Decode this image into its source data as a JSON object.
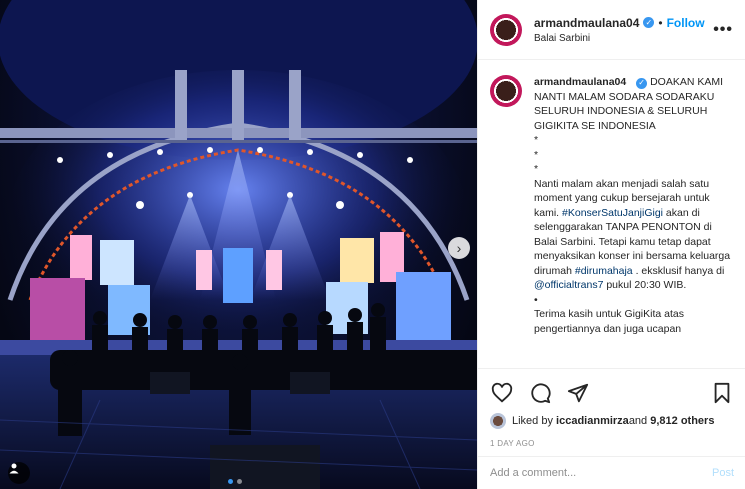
{
  "post": {
    "image_alt": "Concert stage at Balai Sarbini",
    "carousel_dots": 2,
    "active_dot": 0
  },
  "header": {
    "username": "armandmaulana04",
    "verified": true,
    "separator": "•",
    "follow_label": "Follow",
    "location": "Balai Sarbini",
    "more_icon": "more-horizontal-icon",
    "more_glyph": "•••"
  },
  "caption": {
    "username": "armandmaulana04",
    "text_1": "DOAKAN KAMI NANTI MALAM SODARA SODARAKU SELURUH INDONESIA & SELURUH GIGIKITA SE INDONESIA",
    "bullet": "*",
    "text_2a": "Nanti malam akan menjadi salah satu moment yang cukup bersejarah untuk kami. ",
    "hashtag_1": "#KonserSatuJanjiGigi",
    "text_2b": " akan di selenggarakan TANPA PENONTON di Balai Sarbini. Tetapi kamu tetap dapat menyaksikan konser ini bersama keluarga dirumah ",
    "hashtag_2": "#dirumahaja",
    "text_2c": " . eksklusif hanya di ",
    "mention_1": "@officialtrans7",
    "text_2d": " pukul 20:30 WIB.",
    "bullet_2": "•",
    "text_3": "Terima kasih untuk GigiKita atas pengertiannya dan juga ucapan"
  },
  "actions": {
    "like_icon": "heart-icon",
    "comment_icon": "comment-icon",
    "share_icon": "send-icon",
    "save_icon": "bookmark-icon"
  },
  "likes": {
    "prefix": "Liked by ",
    "user": "iccadianmirza",
    "middle": " and ",
    "others": "9,812 others"
  },
  "date": "1 DAY AGO",
  "comment_box": {
    "placeholder": "Add a comment...",
    "post_label": "Post"
  },
  "colors": {
    "accent": "#0095f6",
    "verified": "#3897f0",
    "post_disabled": "#b2dffc",
    "link": "#00376b"
  }
}
